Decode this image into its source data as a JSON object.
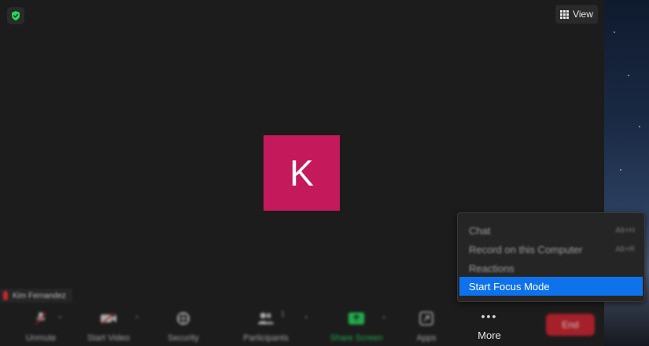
{
  "header": {
    "view_label": "View"
  },
  "participant": {
    "initial": "K",
    "name": "Kim Fernandez",
    "avatar_color": "#c4195a"
  },
  "toolbar": {
    "unmute_label": "Unmute",
    "start_video_label": "Start Video",
    "security_label": "Security",
    "participants_label": "Participants",
    "participants_count": "1",
    "share_screen_label": "Share Screen",
    "apps_label": "Apps",
    "more_label": "More",
    "end_label": "End"
  },
  "more_menu": {
    "items": [
      {
        "label": "Chat",
        "shortcut": "Alt+H"
      },
      {
        "label": "Record on this Computer",
        "shortcut": "Alt+R"
      },
      {
        "label": "Reactions",
        "shortcut": ""
      },
      {
        "label": "Start Focus Mode",
        "shortcut": ""
      }
    ]
  },
  "colors": {
    "accent": "#0e72ed",
    "end_button": "#d3222c",
    "share_green": "#23d959",
    "shield_green": "#23d959"
  },
  "icons": {
    "shield": "shield-check-icon",
    "view": "grid-icon",
    "mic": "microphone-muted-icon",
    "video": "video-off-icon",
    "security": "security-icon",
    "participants": "participants-icon",
    "share": "share-screen-icon",
    "apps": "apps-icon",
    "more": "more-dots-icon"
  }
}
